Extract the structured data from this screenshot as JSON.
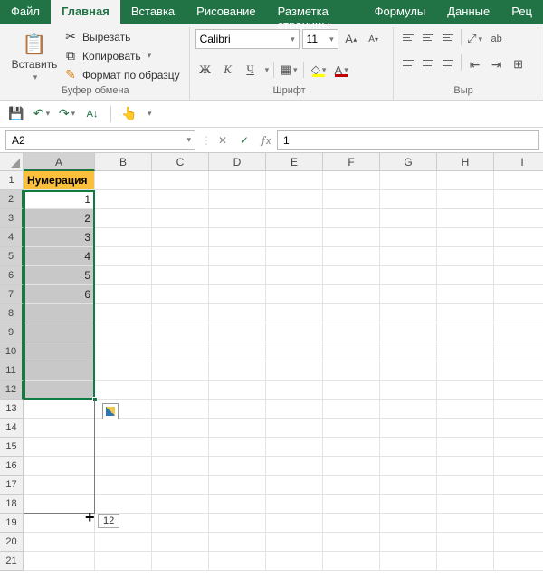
{
  "menu": {
    "tabs": [
      "Файл",
      "Главная",
      "Вставка",
      "Рисование",
      "Разметка страницы",
      "Формулы",
      "Данные",
      "Рец"
    ],
    "active_index": 1
  },
  "ribbon": {
    "clipboard": {
      "paste": "Вставить",
      "cut": "Вырезать",
      "copy": "Копировать",
      "format_painter": "Формат по образцу",
      "title": "Буфер обмена"
    },
    "font": {
      "name": "Calibri",
      "size": "11",
      "bold": "Ж",
      "italic": "К",
      "underline": "Ч",
      "grow": "A",
      "shrink": "A",
      "fill": "A",
      "color": "A",
      "title": "Шрифт"
    },
    "align": {
      "title": "Выр"
    }
  },
  "fbar": {
    "namebox": "A2",
    "formula": "1"
  },
  "sheet": {
    "columns": [
      "A",
      "B",
      "C",
      "D",
      "E",
      "F",
      "G",
      "H",
      "I"
    ],
    "rows": [
      "1",
      "2",
      "3",
      "4",
      "5",
      "6",
      "7",
      "8",
      "9",
      "10",
      "11",
      "12",
      "13",
      "14",
      "15",
      "16",
      "17",
      "18",
      "19",
      "20",
      "21"
    ],
    "cells": {
      "A1": "Нумерация",
      "A2": "1",
      "A3": "2",
      "A4": "3",
      "A5": "4",
      "A6": "5",
      "A7": "6"
    },
    "drag_tip": "12"
  }
}
